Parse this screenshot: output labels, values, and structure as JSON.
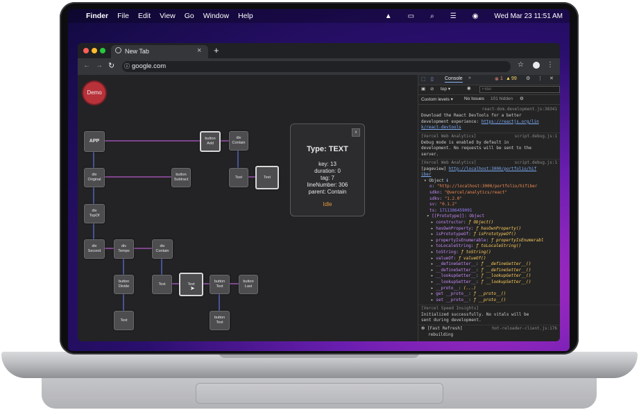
{
  "menubar": {
    "apple_icon": "apple-icon",
    "app_name": "Finder",
    "items": [
      "File",
      "Edit",
      "View",
      "Go",
      "Window",
      "Help"
    ],
    "datetime": "Wed Mar 23  11:51 AM"
  },
  "browser": {
    "tab_title": "New Tab",
    "tab_close": "×",
    "new_tab": "+",
    "url": "google.com"
  },
  "app": {
    "logo_label": "Demo",
    "nodes": {
      "app": "APP",
      "button_add": [
        "button",
        "Add"
      ],
      "div_contain_top": [
        "div",
        "Contain"
      ],
      "text_1": "Text",
      "text_2": "Text",
      "div_original": [
        "div",
        "Original"
      ],
      "button_subtract": [
        "button",
        "Subtract"
      ],
      "div_topof": [
        "div",
        "TopOf"
      ],
      "div_second": [
        "div",
        "Second"
      ],
      "div_tempo": [
        "div",
        "Tempo"
      ],
      "div_contain_mid": [
        "div",
        "Contain"
      ],
      "button_divide": [
        "button",
        "Divide"
      ],
      "text_3": "Text",
      "text_4": "Text",
      "button_text_1": [
        "button",
        "Text"
      ],
      "button_last": [
        "button",
        "Last"
      ],
      "text_5": "Text",
      "button_text_2": [
        "button",
        "Text"
      ]
    },
    "info": {
      "close": "x",
      "title": "Type: TEXT",
      "lines": [
        "key: 13",
        "duration: 0",
        "tag: 7",
        "lineNumber: 306",
        "parent: Contain"
      ],
      "status": "Idle"
    }
  },
  "devtools": {
    "tab_console": "Console",
    "errors": "1",
    "warnings": "99",
    "context": "top",
    "filter_placeholder": "Filter",
    "levels": "Custom levels",
    "issues": "No Issues",
    "hidden": "101 hidden",
    "log": {
      "l1_src": "react-dom.development.js:38341",
      "l1a": "Download the React DevTools for a better",
      "l1b": "development experience: ",
      "l1link": "https://reactjs.org/lin",
      "l1c": "k/react-devtools",
      "l2_tag": "[Vercel Web Analytics]",
      "l2_src": "script.debug.js:1",
      "l2a": " Debug mode is enabled by default in",
      "l2b": "development. No requests will be sent to the",
      "l2c": "server.",
      "l3_tag": "[Vercel Web Analytics]",
      "l3_src": "script.debug.js:1",
      "l3a": " [pageview] ",
      "l3link": "http://localhost:3000/portfolio/hif",
      "l3c": "iber",
      "obj": "Object",
      "o_key": "o",
      "o_val": "\"http://localhost:3000/portfolio/hifiber",
      "sdkn_key": "sdkn",
      "sdkn_val": "\"@vercel/analytics/react\"",
      "sdkv_key": "sdkv",
      "sdkv_val": "\"1.2.0\"",
      "sv_key": "sv",
      "sv_val": "\"0.1.2\"",
      "ts_key": "ts",
      "ts_val": "1711386459091",
      "proto": "[[Prototype]]: Object",
      "proto_items": [
        [
          "constructor",
          "ƒ Object()"
        ],
        [
          "hasOwnProperty",
          "ƒ hasOwnProperty()"
        ],
        [
          "isPrototypeOf",
          "ƒ isPrototypeOf()"
        ],
        [
          "propertyIsEnumerable",
          "ƒ propertyIsEnumerabl"
        ],
        [
          "toLocaleString",
          "ƒ toLocaleString()"
        ],
        [
          "toString",
          "ƒ toString()"
        ],
        [
          "valueOf",
          "ƒ valueOf()"
        ],
        [
          "__defineGetter__",
          "ƒ __defineGetter__()"
        ],
        [
          "__defineSetter__",
          "ƒ __defineSetter__()"
        ],
        [
          "__lookupGetter__",
          "ƒ __lookupGetter__()"
        ],
        [
          "__lookupSetter__",
          "ƒ __lookupSetter__()"
        ],
        [
          "__proto__",
          "(...)"
        ],
        [
          "get __proto__",
          "ƒ __proto__()"
        ],
        [
          "set __proto__",
          "ƒ __proto__()"
        ]
      ],
      "l4_tag": "[Vercel Speed Insights]",
      "l4a": " Initialized successfully. No vitals will be",
      "l4b": "sent during development.",
      "l5_tag": "[Fast Refresh]",
      "l5_src": "hot-reloader-client.js:176",
      "l5a": "rebuilding"
    }
  },
  "colors": {
    "accent_link": "#7cacf8",
    "edge": "#b35cc9",
    "edge_vertical": "#5b6fd6",
    "idle": "#e89a3c",
    "error": "#f28b82",
    "warning": "#fdd663"
  }
}
